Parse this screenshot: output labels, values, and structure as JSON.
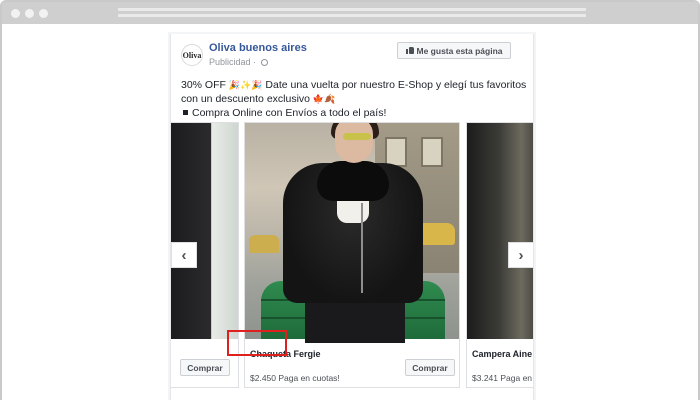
{
  "post": {
    "avatar_text": "Oliva",
    "page_name": "Oliva buenos aires",
    "sponsored_label": "Publicidad",
    "like_page_label": "Me gusta esta página",
    "text_line_1_a": "30% OFF",
    "text_line_1_emoji": "🎉✨🎉",
    "text_line_1_b": "Date una vuelta por nuestro E-Shop y elegí tus favoritos",
    "text_line_2_a": "con un descuento exclusivo",
    "text_line_2_emoji": "🍁🍂",
    "text_line_3": "Compra Online con Envíos a todo el país!"
  },
  "carousel": {
    "cards": [
      {
        "buy_label": "Comprar"
      },
      {
        "title": "Chaqueta Fergie",
        "price": "$2.450 Paga en cuotas!",
        "buy_label": "Comprar"
      },
      {
        "title": "Campera Aine",
        "price": "$3.241 Paga en"
      }
    ],
    "prev_arrow": "‹",
    "next_arrow": "›"
  },
  "colors": {
    "link_blue": "#365899",
    "highlight_red": "#e0201f"
  }
}
